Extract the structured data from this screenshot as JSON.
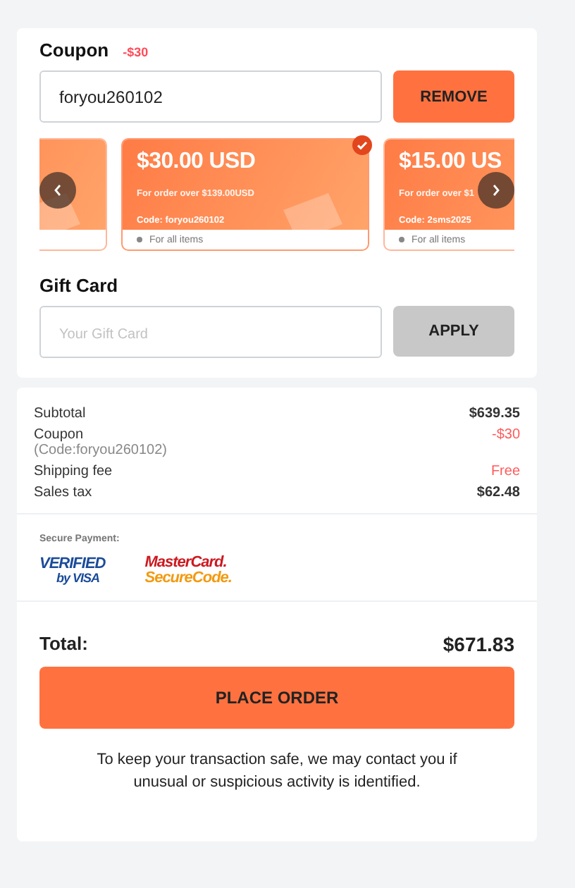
{
  "coupon": {
    "title": "Coupon",
    "discount": "-$30",
    "value": "foryou260102",
    "button": "REMOVE",
    "cards": [
      {
        "selected": false
      },
      {
        "amount": "$30.00 USD",
        "condition": "For order over $139.00USD",
        "code": "Code: foryou260102",
        "scope": "For all items",
        "selected": true
      },
      {
        "amount": "$15.00 US",
        "condition": "For order over $1",
        "code": "Code: 2sms2025",
        "scope": "For all items",
        "selected": false
      }
    ]
  },
  "gift_card": {
    "title": "Gift Card",
    "placeholder": "Your Gift Card",
    "button": "APPLY"
  },
  "summary": [
    {
      "label": "Subtotal",
      "value": "$639.35",
      "color": "#333333"
    },
    {
      "label": "Coupon",
      "note": "(Code:foryou260102)",
      "value": "-$30",
      "color": "#ff5a5a"
    },
    {
      "label": "Shipping fee",
      "value": "Free",
      "color": "#ff5a5a"
    },
    {
      "label": "Sales tax",
      "value": "$62.48",
      "color": "#333333"
    }
  ],
  "secure_payment": {
    "title": "Secure Payment:",
    "logos": [
      {
        "kind": "visa",
        "lines": [
          "VERIFIED",
          "by VISA"
        ]
      },
      {
        "kind": "mastercard",
        "lines": [
          "MasterCard.",
          "SecureCode."
        ]
      }
    ]
  },
  "total": {
    "label": "Total:",
    "value": "$671.83"
  },
  "place_order": "PLACE ORDER",
  "notice": "To keep your transaction safe, we may contact you if unusual or suspicious activity is identified."
}
